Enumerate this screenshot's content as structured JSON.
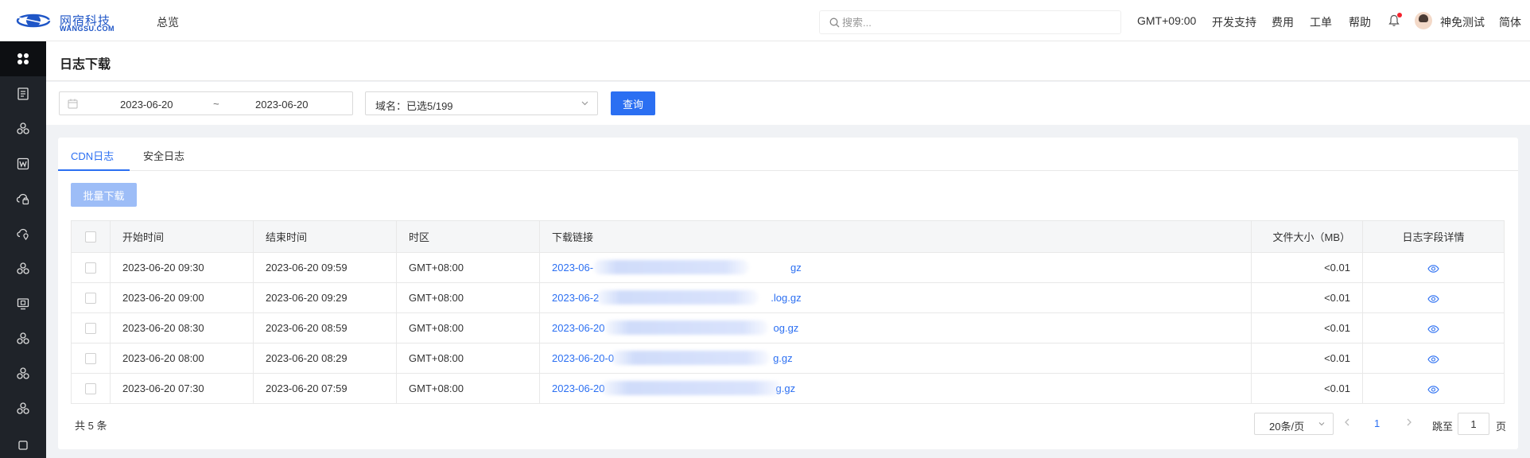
{
  "header": {
    "logo_cn": "网宿科技",
    "logo_en": "WANGSU.COM",
    "nav_overview": "总览",
    "search_placeholder": "搜索...",
    "timezone": "GMT+09:00",
    "dev_support": "开发支持",
    "billing": "费用",
    "ticket": "工单",
    "help": "帮助",
    "username": "神免测试",
    "language": "简体",
    "has_notification": true
  },
  "sidebar": {
    "icons": [
      "apps-icon",
      "list-icon",
      "cluster-icon",
      "w-icon",
      "cloud-lock-icon",
      "cloud-location-icon",
      "cluster-icon",
      "monitor-icon",
      "cluster-icon",
      "cluster-icon",
      "cluster-icon",
      "more-icon"
    ]
  },
  "page": {
    "title": "日志下载"
  },
  "filters": {
    "start_date": "2023-06-20",
    "range_separator": "~",
    "end_date": "2023-06-20",
    "domain_label": "域名：已选5/199",
    "query_button": "查询"
  },
  "tabs": [
    {
      "label": "CDN日志",
      "active": true
    },
    {
      "label": "安全日志",
      "active": false
    }
  ],
  "batch_download_button": "批量下载",
  "table": {
    "columns": [
      "开始时间",
      "结束时间",
      "时区",
      "下载链接",
      "文件大小（MB）",
      "日志字段详情"
    ],
    "rows": [
      {
        "start": "2023-06-20 09:30",
        "end": "2023-06-20 09:59",
        "tz": "GMT+08:00",
        "link_prefix": "2023-06-",
        "link_suffix": "gz",
        "size": "<0.01"
      },
      {
        "start": "2023-06-20 09:00",
        "end": "2023-06-20 09:29",
        "tz": "GMT+08:00",
        "link_prefix": "2023-06-2",
        "link_suffix": ".log.gz",
        "size": "<0.01"
      },
      {
        "start": "2023-06-20 08:30",
        "end": "2023-06-20 08:59",
        "tz": "GMT+08:00",
        "link_prefix": "2023-06-20",
        "link_suffix": "og.gz",
        "size": "<0.01"
      },
      {
        "start": "2023-06-20 08:00",
        "end": "2023-06-20 08:29",
        "tz": "GMT+08:00",
        "link_prefix": "2023-06-20-0",
        "link_suffix": "g.gz",
        "size": "<0.01"
      },
      {
        "start": "2023-06-20 07:30",
        "end": "2023-06-20 07:59",
        "tz": "GMT+08:00",
        "link_prefix": "2023-06-20",
        "link_suffix": "g.gz",
        "size": "<0.01"
      }
    ]
  },
  "pagination": {
    "total": "共 5 条",
    "page_size": "20条/页",
    "current_page": "1",
    "jump_label": "跳至",
    "jump_value": "1",
    "jump_suffix": "页"
  },
  "colors": {
    "accent": "#2b6ff2",
    "sidebar_bg": "#1f2329",
    "notification_dot": "#f5222d"
  }
}
